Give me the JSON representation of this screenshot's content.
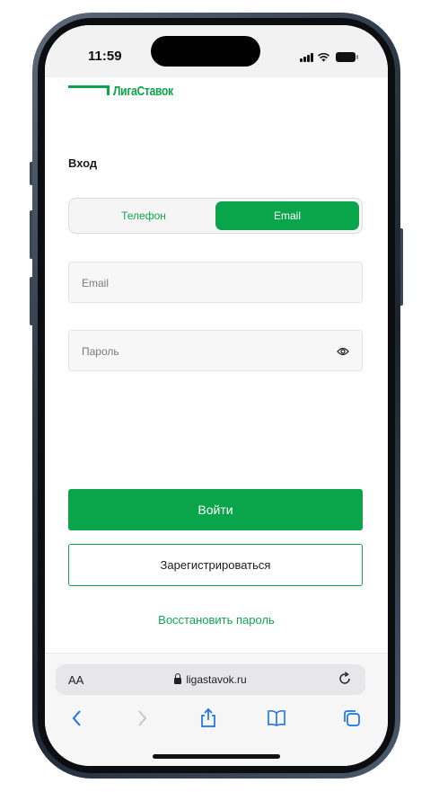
{
  "status": {
    "time": "11:59"
  },
  "brand": {
    "logo_text": "ЛигаСтавок",
    "accent": "#0aa54a"
  },
  "login": {
    "heading": "Вход",
    "tabs": [
      {
        "label": "Телефон",
        "active": false
      },
      {
        "label": "Email",
        "active": true
      }
    ],
    "email_placeholder": "Email",
    "password_placeholder": "Пароль",
    "submit_label": "Войти",
    "register_label": "Зарегистрироваться",
    "recover_label": "Восстановить пароль"
  },
  "browser": {
    "text_size_label": "AA",
    "url": "ligastavok.ru",
    "icons": [
      "lock-icon",
      "reload-icon",
      "back-icon",
      "forward-icon",
      "share-icon",
      "bookmarks-icon",
      "tabs-icon"
    ]
  }
}
